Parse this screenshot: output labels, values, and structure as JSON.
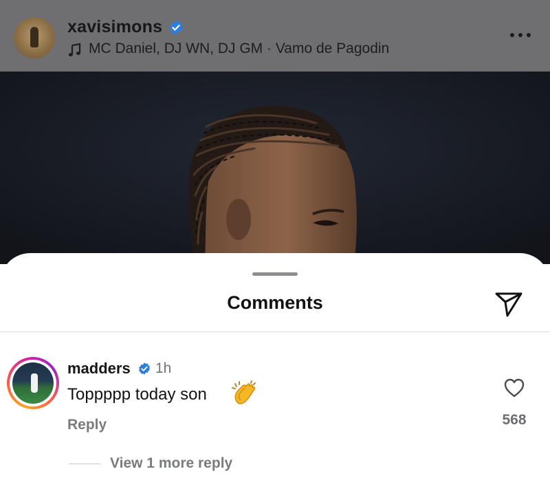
{
  "post": {
    "username": "xavisimons",
    "audio": "MC Daniel, DJ WN, DJ GM · Vamo de Pagodin",
    "icons": {
      "verified": "verified-badge-icon",
      "music": "music-note-icon",
      "more": "more-options-icon"
    }
  },
  "comments_sheet": {
    "title": "Comments",
    "share_icon": "send-icon"
  },
  "comment": {
    "username": "madders",
    "time": "1h",
    "text": "Toppppp today son",
    "emoji": "clapping-hands",
    "reply_label": "Reply",
    "like_count": "568",
    "view_replies": "View 1 more reply"
  },
  "colors": {
    "verified_blue": "#2f7fd9",
    "header_dim": "#6f6f71",
    "muted_text": "#7a7b80"
  }
}
